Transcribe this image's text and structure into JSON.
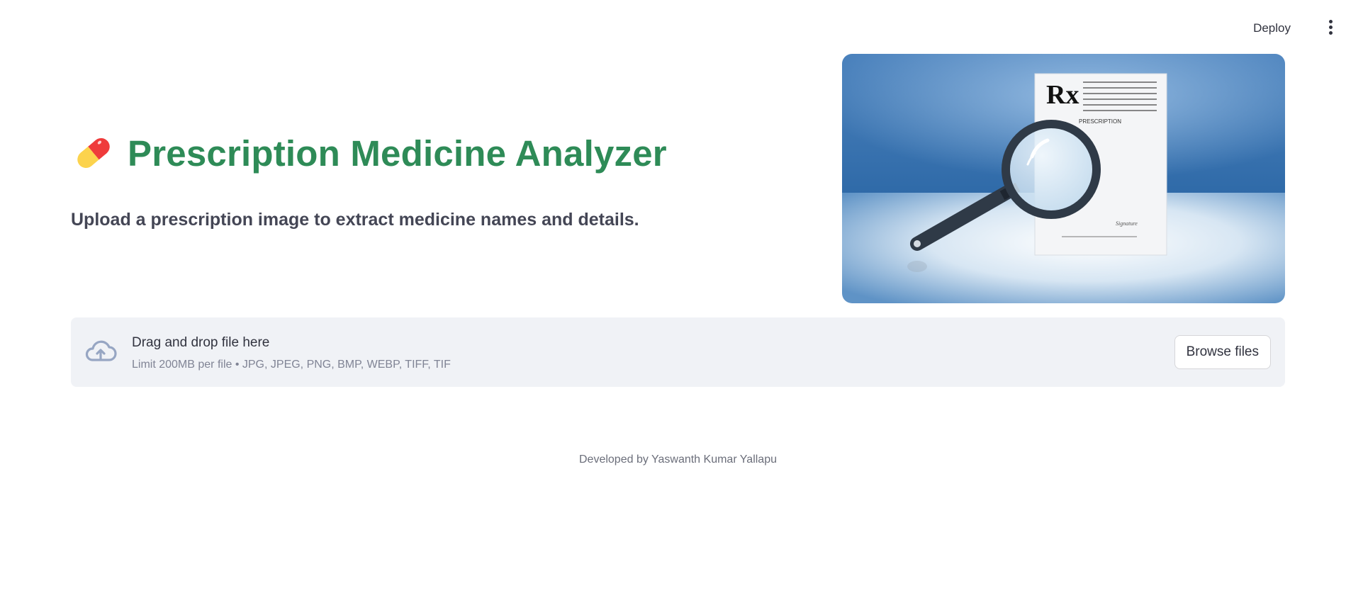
{
  "header": {
    "deploy_label": "Deploy",
    "menu_icon": "kebab-menu-icon"
  },
  "main": {
    "title_icon": "pill-icon",
    "title": "Prescription Medicine Analyzer",
    "subtitle": "Upload a prescription image to extract medicine names and details.",
    "hero_image": {
      "rx_mark": "Rx",
      "document_label": "PRESCRIPTION",
      "signature_text": "Signature",
      "icon": "magnifying-glass-icon"
    }
  },
  "uploader": {
    "icon": "cloud-upload-icon",
    "drop_label": "Drag and drop file here",
    "limit_text": "Limit 200MB per file • JPG, JPEG, PNG, BMP, WEBP, TIFF, TIF",
    "browse_label": "Browse files"
  },
  "footer": {
    "credit": "Developed by Yaswanth Kumar Yallapu"
  },
  "colors": {
    "title_green": "#2e8b57",
    "uploader_bg": "#f0f2f6",
    "text_dark": "#31333f",
    "text_muted": "#808495",
    "hero_blue": "#3f7ab5"
  }
}
